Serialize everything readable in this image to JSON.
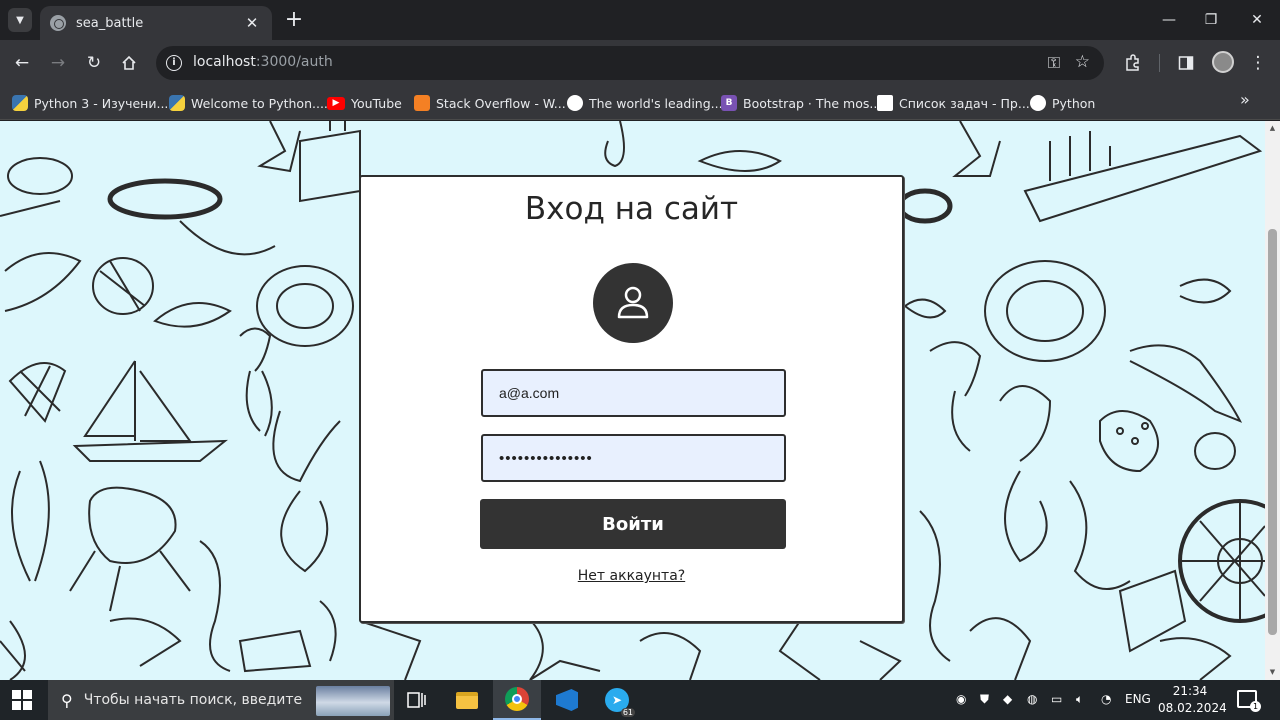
{
  "browser": {
    "tab": {
      "title": "sea_battle",
      "close": "✕"
    },
    "new_tab": "+",
    "window_controls": {
      "minimize": "—",
      "restore": "❐",
      "close": "✕"
    },
    "url": {
      "host": "localhost",
      "rest": ":3000/auth"
    },
    "bookmarks": [
      {
        "label": "Python 3 - Изучени...",
        "icon": "python-icon"
      },
      {
        "label": "Welcome to Python....",
        "icon": "python-icon"
      },
      {
        "label": "YouTube",
        "icon": "youtube-icon"
      },
      {
        "label": "Stack Overflow - W...",
        "icon": "stackoverflow-icon"
      },
      {
        "label": "The world's leading...",
        "icon": "github-icon"
      },
      {
        "label": "Bootstrap · The mos...",
        "icon": "bootstrap-icon"
      },
      {
        "label": "Список задач - Пр...",
        "icon": "tasklist-icon"
      },
      {
        "label": "Python",
        "icon": "python-icon"
      }
    ],
    "bootstrap_glyph": "B",
    "more_bookmarks": "»"
  },
  "auth": {
    "heading": "Вход на сайт",
    "email_value": "a@a.com",
    "password_masked": "•••••••••••••••",
    "submit_label": "Войти",
    "register_link": "Нет аккаунта?"
  },
  "taskbar": {
    "search_placeholder": "Чтобы начать поиск, введите",
    "telegram_badge": "61",
    "language": "ENG",
    "time": "21:34",
    "date": "08.02.2024",
    "notification_count": "1"
  },
  "colors": {
    "page_background": "#ddf7fc",
    "card_background": "#ffffff",
    "button_dark": "#333333",
    "field_fill": "#e8f0fe"
  }
}
